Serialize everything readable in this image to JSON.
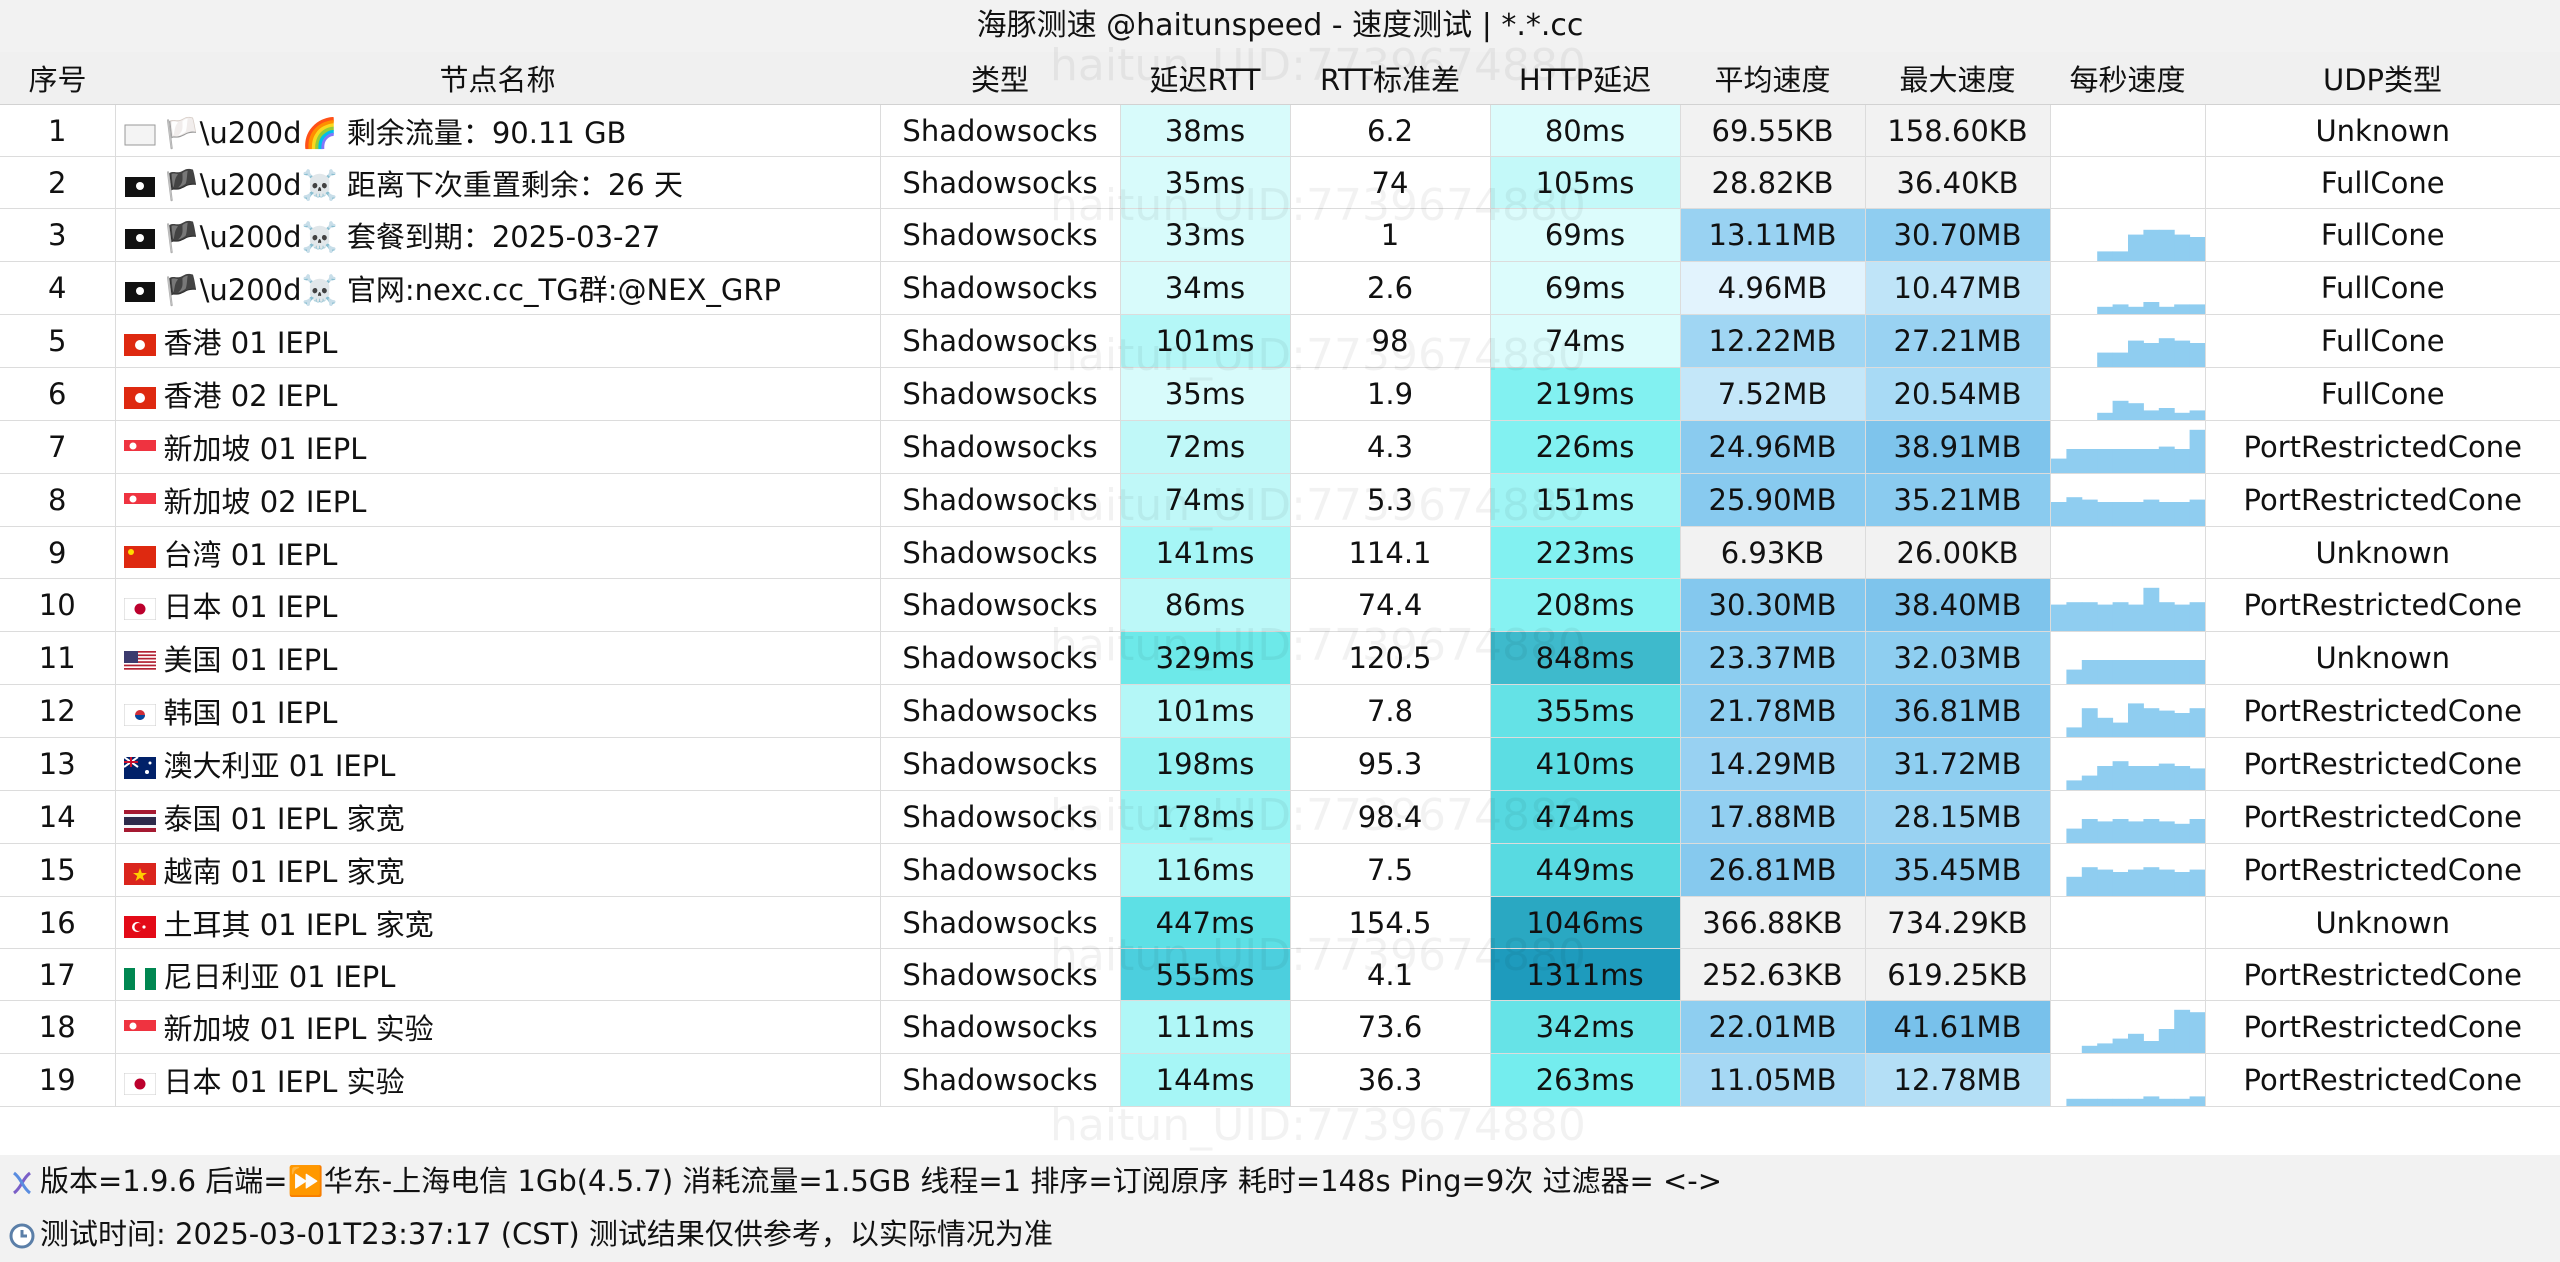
{
  "title": "海豚测速 @haitunspeed - 速度测试 | *.*.cc",
  "watermark_text": "haitun_UID:7739674880",
  "columns": [
    "序号",
    "节点名称",
    "类型",
    "延迟RTT",
    "RTT标准差",
    "HTTP延迟",
    "平均速度",
    "最大速度",
    "每秒速度",
    "UDP类型"
  ],
  "rows": [
    {
      "idx": "1",
      "flag": "white-flag-rainbow",
      "name": "🏳️\\u200d🌈 剩余流量：90.11 GB",
      "type": "Shadowsocks",
      "rtt": "38ms",
      "std": "6.2",
      "http": "80ms",
      "avg": "69.55KB",
      "max": "158.60KB",
      "udp": "Unknown",
      "c_rtt": "#d8fbfb",
      "c_http": "#dcfcfc",
      "c_avg": "#f2f2f2",
      "c_max": "#f2f2f2",
      "spark": []
    },
    {
      "idx": "2",
      "flag": "black-flag-pirate",
      "name": "🏴\\u200d☠️ 距离下次重置剩余：26 天",
      "type": "Shadowsocks",
      "rtt": "35ms",
      "std": "74",
      "http": "105ms",
      "avg": "28.82KB",
      "max": "36.40KB",
      "udp": "FullCone",
      "c_rtt": "#d8fbfb",
      "c_http": "#c4f9f9",
      "c_avg": "#f2f2f2",
      "c_max": "#f2f2f2",
      "spark": []
    },
    {
      "idx": "3",
      "flag": "black-flag-pirate",
      "name": "🏴\\u200d☠️ 套餐到期：2025-03-27",
      "type": "Shadowsocks",
      "rtt": "33ms",
      "std": "1",
      "http": "69ms",
      "avg": "13.11MB",
      "max": "30.70MB",
      "udp": "FullCone",
      "c_rtt": "#d8fbfb",
      "c_http": "#dcfcfc",
      "c_avg": "#99d2f2",
      "c_max": "#8fcdf0",
      "spark": [
        0,
        0,
        0,
        0.2,
        0.2,
        0.55,
        0.65,
        0.65,
        0.55,
        0.5
      ]
    },
    {
      "idx": "4",
      "flag": "black-flag-pirate",
      "name": "🏴\\u200d☠️ 官网:nexc.cc_TG群:@NEX_GRP",
      "type": "Shadowsocks",
      "rtt": "34ms",
      "std": "2.6",
      "http": "69ms",
      "avg": "4.96MB",
      "max": "10.47MB",
      "udp": "FullCone",
      "c_rtt": "#d8fbfb",
      "c_http": "#dcfcfc",
      "c_avg": "#e2f3fd",
      "c_max": "#bfe4f8",
      "spark": [
        0,
        0,
        0,
        0.15,
        0.2,
        0.15,
        0.25,
        0.15,
        0.2,
        0.2
      ]
    },
    {
      "idx": "5",
      "flag": "hk",
      "name": "香港 01 IEPL",
      "type": "Shadowsocks",
      "rtt": "101ms",
      "std": "98",
      "http": "74ms",
      "avg": "12.22MB",
      "max": "27.21MB",
      "udp": "FullCone",
      "c_rtt": "#b4f7f7",
      "c_http": "#dcfcfc",
      "c_avg": "#a0d6f3",
      "c_max": "#99d2f2",
      "spark": [
        0,
        0,
        0,
        0.3,
        0.3,
        0.55,
        0.5,
        0.6,
        0.55,
        0.5
      ]
    },
    {
      "idx": "6",
      "flag": "hk",
      "name": "香港 02 IEPL",
      "type": "Shadowsocks",
      "rtt": "35ms",
      "std": "1.9",
      "http": "219ms",
      "avg": "7.52MB",
      "max": "20.54MB",
      "udp": "FullCone",
      "c_rtt": "#d8fbfb",
      "c_http": "#82f1f1",
      "c_avg": "#c4e7f9",
      "c_max": "#a8daf5",
      "spark": [
        0,
        0,
        0,
        0.15,
        0.4,
        0.35,
        0.2,
        0.25,
        0.15,
        0.2
      ]
    },
    {
      "idx": "7",
      "flag": "sg",
      "name": "新加坡 01 IEPL",
      "type": "Shadowsocks",
      "rtt": "72ms",
      "std": "4.3",
      "http": "226ms",
      "avg": "24.96MB",
      "max": "38.91MB",
      "udp": "PortRestrictedCone",
      "c_rtt": "#c0f8f8",
      "c_http": "#82f1f1",
      "c_avg": "#8acbef",
      "c_max": "#7ec4ec",
      "spark": [
        0.3,
        0.5,
        0.5,
        0.5,
        0.5,
        0.5,
        0.5,
        0.55,
        0.5,
        0.9
      ]
    },
    {
      "idx": "8",
      "flag": "sg",
      "name": "新加坡 02 IEPL",
      "type": "Shadowsocks",
      "rtt": "74ms",
      "std": "5.3",
      "http": "151ms",
      "avg": "25.90MB",
      "max": "35.21MB",
      "udp": "PortRestrictedCone",
      "c_rtt": "#c0f8f8",
      "c_http": "#a0f5f5",
      "c_avg": "#88caef",
      "c_max": "#8acbef",
      "spark": [
        0.5,
        0.6,
        0.55,
        0.5,
        0.5,
        0.5,
        0.55,
        0.5,
        0.5,
        0.55
      ]
    },
    {
      "idx": "9",
      "flag": "cn",
      "name": "台湾 01 IEPL",
      "type": "Shadowsocks",
      "rtt": "141ms",
      "std": "114.1",
      "http": "223ms",
      "avg": "6.93KB",
      "max": "26.00KB",
      "udp": "Unknown",
      "c_rtt": "#a6f6f6",
      "c_http": "#82f1f1",
      "c_avg": "#f2f2f2",
      "c_max": "#f2f2f2",
      "spark": []
    },
    {
      "idx": "10",
      "flag": "jp",
      "name": "日本 01 IEPL",
      "type": "Shadowsocks",
      "rtt": "86ms",
      "std": "74.4",
      "http": "208ms",
      "avg": "30.30MB",
      "max": "38.40MB",
      "udp": "PortRestrictedCone",
      "c_rtt": "#bcf8f8",
      "c_http": "#86f2f2",
      "c_avg": "#84c8ee",
      "c_max": "#7ec4ec",
      "spark": [
        0.55,
        0.6,
        0.6,
        0.55,
        0.6,
        0.55,
        0.9,
        0.6,
        0.55,
        0.6
      ]
    },
    {
      "idx": "11",
      "flag": "us",
      "name": "美国 01 IEPL",
      "type": "Shadowsocks",
      "rtt": "329ms",
      "std": "120.5",
      "http": "848ms",
      "avg": "23.37MB",
      "max": "32.03MB",
      "udp": "Unknown",
      "c_rtt": "#6de9e9",
      "c_http": "#3ebacc",
      "c_avg": "#8ccdf0",
      "c_max": "#8ecef0",
      "spark": [
        0,
        0.3,
        0.5,
        0.5,
        0.5,
        0.5,
        0.5,
        0.5,
        0.5,
        0.5
      ]
    },
    {
      "idx": "12",
      "flag": "kr",
      "name": "韩国 01 IEPL",
      "type": "Shadowsocks",
      "rtt": "101ms",
      "std": "7.8",
      "http": "355ms",
      "avg": "21.78MB",
      "max": "36.81MB",
      "udp": "PortRestrictedCone",
      "c_rtt": "#b4f7f7",
      "c_http": "#64e2e6",
      "c_avg": "#8ecef0",
      "c_max": "#84c8ee",
      "spark": [
        0,
        0.2,
        0.6,
        0.4,
        0.3,
        0.7,
        0.6,
        0.55,
        0.5,
        0.6
      ]
    },
    {
      "idx": "13",
      "flag": "au",
      "name": "澳大利亚 01 IEPL",
      "type": "Shadowsocks",
      "rtt": "198ms",
      "std": "95.3",
      "http": "410ms",
      "avg": "14.29MB",
      "max": "31.72MB",
      "udp": "PortRestrictedCone",
      "c_rtt": "#94f2f2",
      "c_http": "#5cdde3",
      "c_avg": "#98d1f2",
      "c_max": "#8ecef0",
      "spark": [
        0,
        0.2,
        0.3,
        0.5,
        0.6,
        0.5,
        0.5,
        0.55,
        0.5,
        0.45
      ]
    },
    {
      "idx": "14",
      "flag": "th",
      "name": "泰国 01 IEPL 家宽",
      "type": "Shadowsocks",
      "rtt": "178ms",
      "std": "98.4",
      "http": "474ms",
      "avg": "17.88MB",
      "max": "28.15MB",
      "udp": "PortRestrictedCone",
      "c_rtt": "#9af4f4",
      "c_http": "#56d8e0",
      "c_avg": "#92cff1",
      "c_max": "#99d2f2",
      "spark": [
        0,
        0.3,
        0.5,
        0.45,
        0.5,
        0.45,
        0.5,
        0.45,
        0.4,
        0.5
      ]
    },
    {
      "idx": "15",
      "flag": "vn",
      "name": "越南 01 IEPL 家宽",
      "type": "Shadowsocks",
      "rtt": "116ms",
      "std": "7.5",
      "http": "449ms",
      "avg": "26.81MB",
      "max": "35.45MB",
      "udp": "PortRestrictedCone",
      "c_rtt": "#aff7f7",
      "c_http": "#58dae1",
      "c_avg": "#86c9ee",
      "c_max": "#8acbef",
      "spark": [
        0,
        0.4,
        0.6,
        0.55,
        0.5,
        0.55,
        0.6,
        0.55,
        0.5,
        0.55
      ]
    },
    {
      "idx": "16",
      "flag": "tr",
      "name": "土耳其 01 IEPL 家宽",
      "type": "Shadowsocks",
      "rtt": "447ms",
      "std": "154.5",
      "http": "1046ms",
      "avg": "366.88KB",
      "max": "734.29KB",
      "udp": "Unknown",
      "c_rtt": "#5de0e5",
      "c_http": "#2aa8c2",
      "c_avg": "#f2f2f2",
      "c_max": "#f2f2f2",
      "spark": []
    },
    {
      "idx": "17",
      "flag": "ng",
      "name": "尼日利亚 01 IEPL",
      "type": "Shadowsocks",
      "rtt": "555ms",
      "std": "4.1",
      "http": "1311ms",
      "avg": "252.63KB",
      "max": "619.25KB",
      "udp": "PortRestrictedCone",
      "c_rtt": "#4ccfde",
      "c_http": "#1e9bbd",
      "c_avg": "#f2f2f2",
      "c_max": "#f2f2f2",
      "spark": []
    },
    {
      "idx": "18",
      "flag": "sg",
      "name": "新加坡 01 IEPL 实验",
      "type": "Shadowsocks",
      "rtt": "111ms",
      "std": "73.6",
      "http": "342ms",
      "avg": "22.01MB",
      "max": "41.61MB",
      "udp": "PortRestrictedCone",
      "c_rtt": "#b0f7f7",
      "c_http": "#66e3e7",
      "c_avg": "#8ecef0",
      "c_max": "#78c1eb",
      "spark": [
        0,
        0,
        0.15,
        0.2,
        0.3,
        0.4,
        0.25,
        0.5,
        0.9,
        0.85
      ]
    },
    {
      "idx": "19",
      "flag": "jp",
      "name": "日本 01 IEPL 实验",
      "type": "Shadowsocks",
      "rtt": "144ms",
      "std": "36.3",
      "http": "263ms",
      "avg": "11.05MB",
      "max": "12.78MB",
      "udp": "PortRestrictedCone",
      "c_rtt": "#a6f6f6",
      "c_http": "#74edee",
      "c_avg": "#a6d8f4",
      "c_max": "#b4dff6",
      "spark": [
        0,
        0.15,
        0.15,
        0.15,
        0.15,
        0.15,
        0.2,
        0.15,
        0.15,
        0.2
      ]
    }
  ],
  "footer": {
    "line1": "版本=1.9.6  后端=⏩华东-上海电信 1Gb(4.5.7) 消耗流量=1.5GB  线程=1  排序=订阅原序  耗时=148s  Ping=9次  过滤器= <->",
    "line2": "测试时间: 2025-03-01T23:37:17 (CST)  测试结果仅供参考，以实际情况为准"
  },
  "colors": {
    "spark": "#8fcdf0",
    "header_bg": "#f0f0f0"
  }
}
